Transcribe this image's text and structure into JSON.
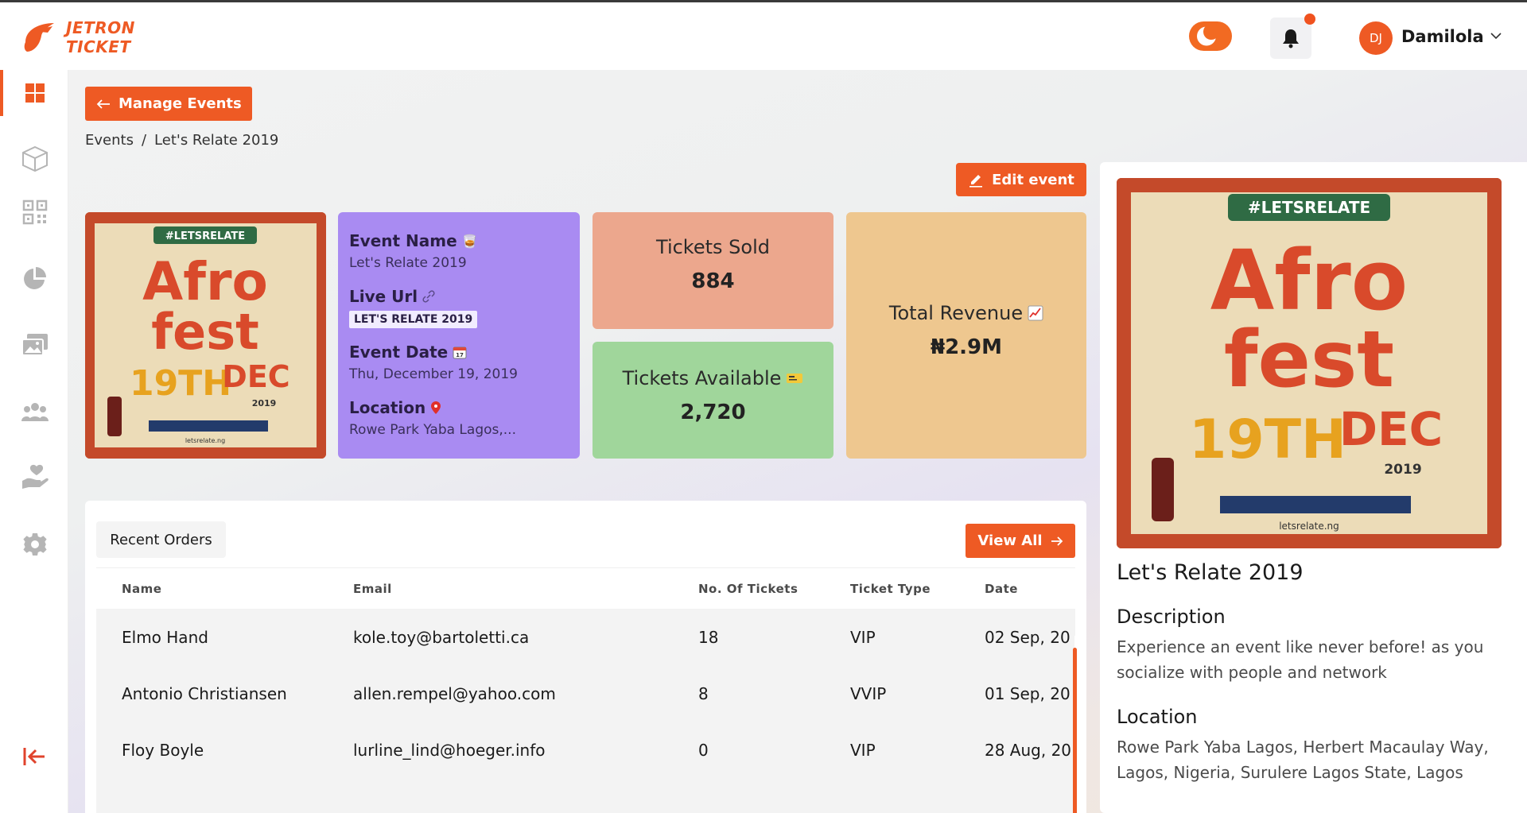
{
  "brand": {
    "line1": "JETRON",
    "line2": "TICKET",
    "accent": "#ee5a24"
  },
  "header": {
    "user_initials": "DJ",
    "user_name": "Damilola",
    "icons": [
      "moon-toggle-icon",
      "bell-icon",
      "chevron-down-icon"
    ]
  },
  "sidebar": {
    "items": [
      {
        "name": "dashboard",
        "icon": "grid-icon",
        "active": true
      },
      {
        "name": "events",
        "icon": "box-icon"
      },
      {
        "name": "qr",
        "icon": "qr-code-icon"
      },
      {
        "name": "analytics",
        "icon": "pie-chart-icon"
      },
      {
        "name": "gallery",
        "icon": "images-icon"
      },
      {
        "name": "team",
        "icon": "people-icon"
      },
      {
        "name": "donations",
        "icon": "hand-heart-icon"
      },
      {
        "name": "settings",
        "icon": "gear-icon"
      },
      {
        "name": "logout",
        "icon": "logout-icon"
      }
    ]
  },
  "page": {
    "back_label": "Manage Events",
    "breadcrumb": {
      "root": "Events",
      "separator": "/",
      "current": "Let's Relate 2019"
    },
    "edit_label": "Edit event"
  },
  "poster": {
    "hashtag": "#LETSRELATE",
    "line1": "Afro",
    "line2": "fest",
    "day": "19TH",
    "month": "DEC",
    "year": "2019",
    "handle": "letsrelate.ng"
  },
  "info_card": {
    "name_label": "Event Name",
    "name_value": "Let's Relate 2019",
    "url_label": "Live Url",
    "url_value": "LET'S RELATE 2019",
    "date_label": "Event Date",
    "date_value": "Thu, December 19, 2019",
    "location_label": "Location",
    "location_value": "Rowe Park Yaba Lagos,..."
  },
  "stats": {
    "sold_label": "Tickets Sold",
    "sold_value": "884",
    "available_label": "Tickets Available",
    "available_value": "2,720",
    "revenue_label": "Total Revenue",
    "revenue_value": "₦2.9M"
  },
  "orders": {
    "tab_label": "Recent Orders",
    "view_all_label": "View All",
    "columns": [
      "Name",
      "Email",
      "No. Of Tickets",
      "Ticket Type",
      "Date"
    ],
    "rows": [
      {
        "name": "Elmo Hand",
        "email": "kole.toy@bartoletti.ca",
        "tickets": "18",
        "type": "VIP",
        "date": "02 Sep, 20"
      },
      {
        "name": "Antonio Christiansen",
        "email": "allen.rempel@yahoo.com",
        "tickets": "8",
        "type": "VVIP",
        "date": "01 Sep, 20"
      },
      {
        "name": "Floy Boyle",
        "email": "lurline_lind@hoeger.info",
        "tickets": "0",
        "type": "VIP",
        "date": "28 Aug, 20"
      }
    ]
  },
  "detail": {
    "title": "Let's Relate 2019",
    "description_heading": "Description",
    "description": "Experience an event like never before! as you socialize with people and network",
    "location_heading": "Location",
    "location": "Rowe Park Yaba Lagos, Herbert Macaulay Way, Lagos, Nigeria, Surulere Lagos State, Lagos"
  }
}
